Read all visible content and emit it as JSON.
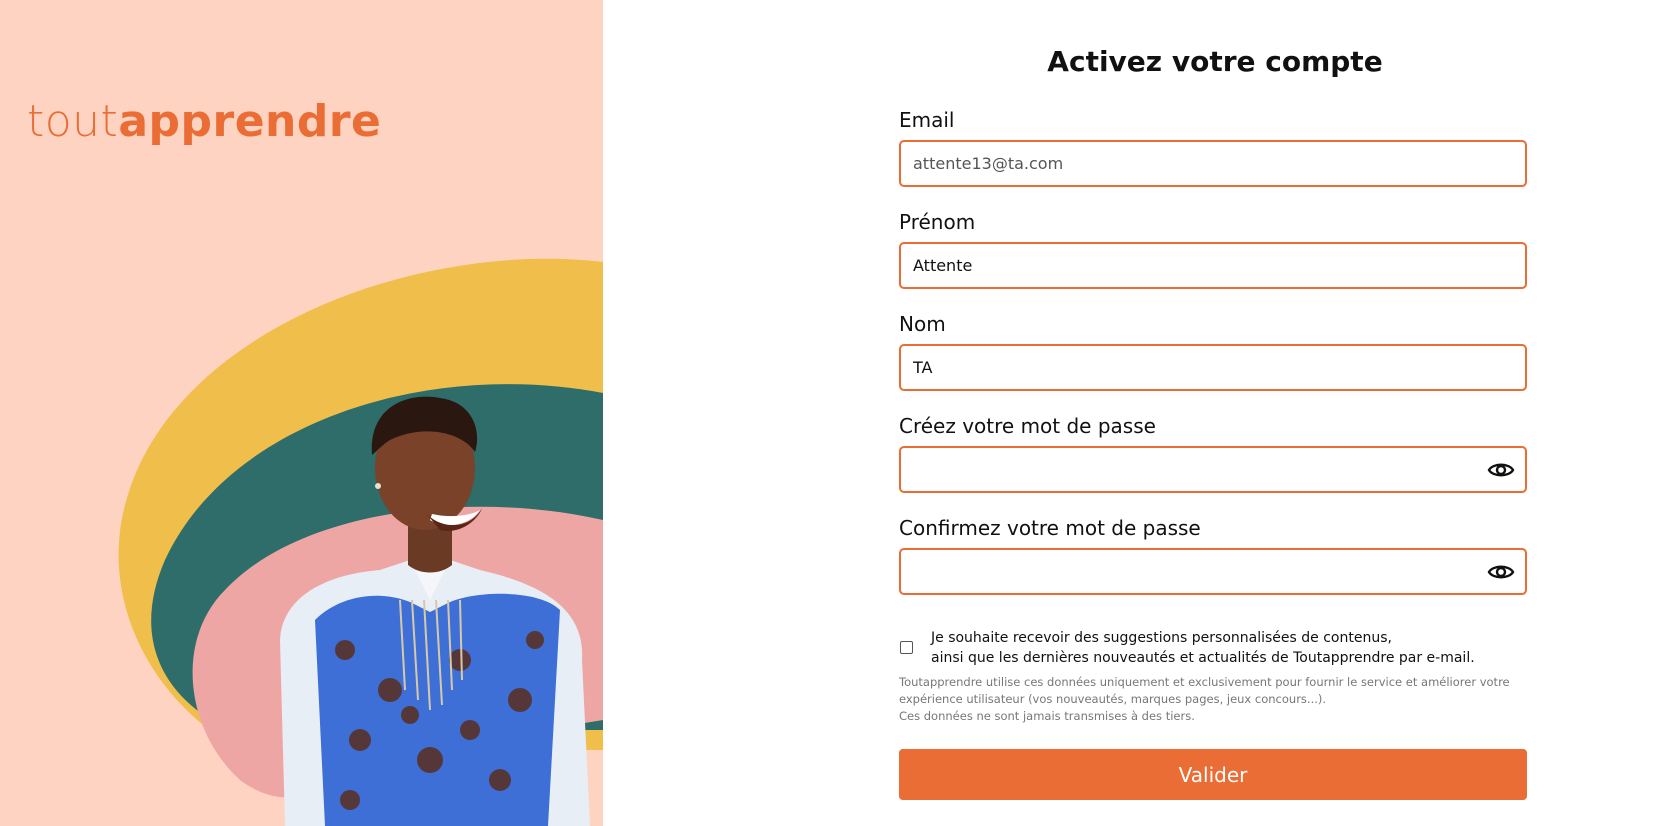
{
  "brand": {
    "logo_light": "tout",
    "logo_bold": "apprendre",
    "accent_color": "#E96D35",
    "panel_color": "#FFD3C1"
  },
  "form": {
    "title": "Activez votre compte",
    "email": {
      "label": "Email",
      "value": "attente13@ta.com"
    },
    "firstname": {
      "label": "Prénom",
      "value": "Attente"
    },
    "lastname": {
      "label": "Nom",
      "value": "TA"
    },
    "password": {
      "label": "Créez votre mot de passe",
      "value": "",
      "icon": "eye-icon"
    },
    "password_confirm": {
      "label": "Confirmez votre mot de passe",
      "value": "",
      "icon": "eye-icon"
    },
    "consent": {
      "line1": "Je souhaite recevoir des suggestions personnalisées de contenus,",
      "line2": "ainsi que les dernières nouveautés et actualités de Toutapprendre par e-mail.",
      "checked": false
    },
    "fineprint": {
      "line1": "Toutapprendre utilise ces données uniquement et exclusivement pour fournir le service et améliorer votre",
      "line2": "expérience utilisateur (vos nouveautés, marques pages, jeux concours...).",
      "line3": "Ces données ne sont jamais transmises à des tiers."
    },
    "submit_label": "Valider"
  }
}
